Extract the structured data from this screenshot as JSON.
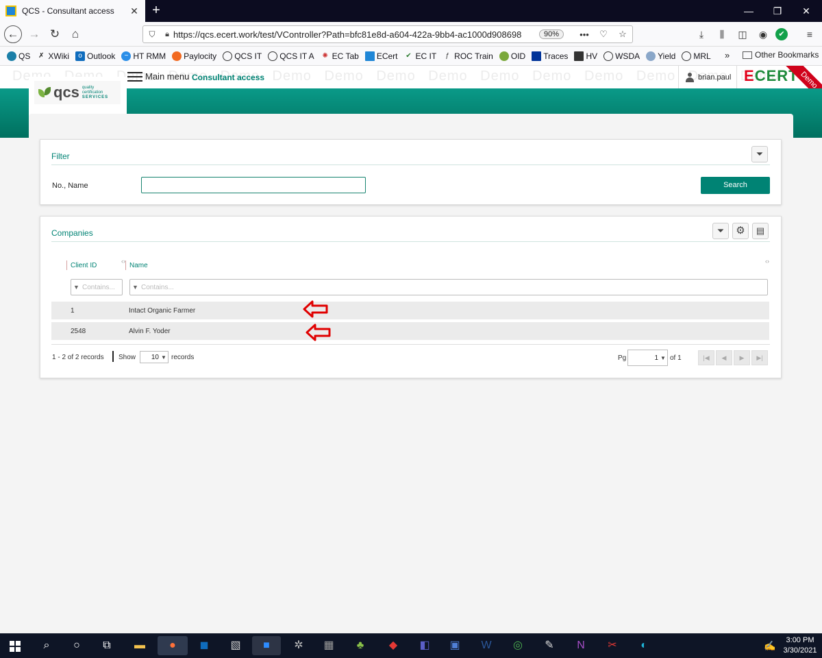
{
  "browser": {
    "tab_title": "QCS - Consultant access",
    "url": "https://qcs.ecert.work/test/VController?Path=bfc81e8d-a604-422a-9bb4-ac1000d908698",
    "zoom": "90%",
    "bookmarks": [
      "QS",
      "XWiki",
      "Outlook",
      "HT RMM",
      "Paylocity",
      "QCS IT",
      "QCS IT A",
      "EC Tab",
      "ECert",
      "EC IT",
      "ROC Train",
      "OID",
      "Traces",
      "HV",
      "WSDA",
      "Yield",
      "MRL"
    ],
    "other_bookmarks": "Other Bookmarks"
  },
  "header": {
    "watermark": "Demo Demo Demo Demo Demo Demo Demo Demo Demo Demo Demo Demo Demo Demo Demo",
    "menu_label": "Main menu",
    "app_title": "Consultant access",
    "username": "brian.paul",
    "brand_e": "E",
    "brand_rest": "CERT",
    "ribbon": "Demo",
    "logo_text": "qcs",
    "logo_sub1": "quality",
    "logo_sub2": "certification",
    "logo_sub3": "SERVICES"
  },
  "filter": {
    "title": "Filter",
    "label": "No., Name",
    "value": "",
    "search_label": "Search"
  },
  "companies": {
    "title": "Companies",
    "columns": [
      "Client ID",
      "Name"
    ],
    "filter_placeholder": "Contains...",
    "rows": [
      {
        "id": "1",
        "name": "Intact Organic Farmer"
      },
      {
        "id": "2548",
        "name": "Alvin F. Yoder"
      }
    ],
    "records_text": "1 - 2 of 2 records",
    "show_label": "Show",
    "page_size": "10",
    "records_label": "records",
    "pg_label": "Pg",
    "page": "1",
    "of_pages": "of 1"
  },
  "taskbar": {
    "time": "3:00 PM",
    "date": "3/30/2021"
  },
  "colors": {
    "accent": "#008374",
    "arrow": "#e00000",
    "ribbon": "#d0021b"
  }
}
